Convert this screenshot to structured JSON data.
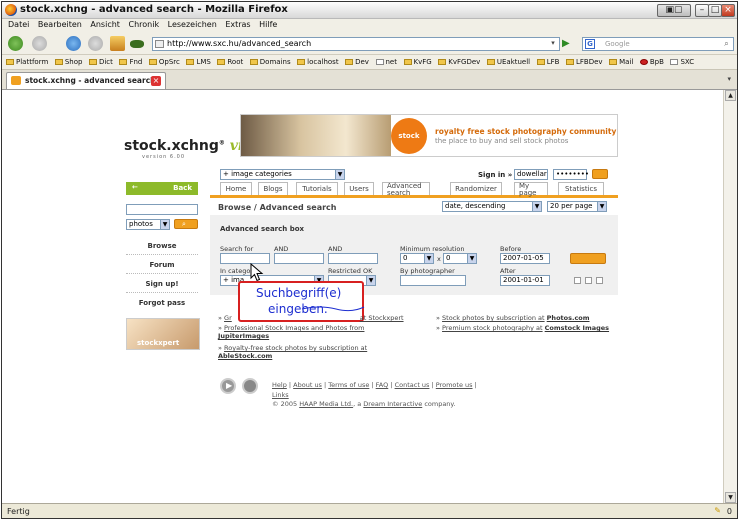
{
  "window": {
    "title": "stock.xchng - advanced search - Mozilla Firefox"
  },
  "menu": [
    "Datei",
    "Bearbeiten",
    "Ansicht",
    "Chronik",
    "Lesezeichen",
    "Extras",
    "Hilfe"
  ],
  "nav": {
    "url": "http://www.sxc.hu/advanced_search",
    "search_placeholder": "Google"
  },
  "bookmarks": [
    "Plattform",
    "Shop",
    "Dict",
    "Fnd",
    "OpSrc",
    "LMS",
    "Root",
    "Domains",
    "localhost",
    "Dev",
    "net",
    "KvFG",
    "KvFGDev",
    "UEaktuell",
    "LFB",
    "LFBDev",
    "Mail",
    "BpB",
    "SXC"
  ],
  "tab": {
    "label": "stock.xchng - advanced search"
  },
  "status": {
    "text": "Fertig",
    "count": "0"
  },
  "site": {
    "logo": "stock.xchng",
    "logo_vi": "vi",
    "logo_sub": "version 6.00",
    "banner_badge": "stock xpert",
    "banner_line1": "royalty free stock photography community",
    "banner_line2": "the place to buy and sell stock photos",
    "category_select": "+ image categories",
    "signin_label": "Sign in »",
    "signin_user": "dowellar",
    "signin_pass": "••••••••"
  },
  "leftnav": {
    "back": "Back",
    "search_type": "photos",
    "items": [
      "Browse",
      "Forum",
      "Sign up!",
      "Forgot pass"
    ],
    "banner": "stockxpert"
  },
  "navtabs": [
    "Home",
    "Blogs",
    "Tutorials",
    "Users",
    "Advanced search",
    "Randomizer",
    "My page",
    "Statistics"
  ],
  "breadcrumb": "Browse / Advanced search",
  "sort": {
    "order": "date, descending",
    "per_page": "20 per page"
  },
  "panel": {
    "title": "Advanced search box",
    "search_for": "Search for",
    "and1": "AND",
    "and2": "AND",
    "in_category": "In category",
    "category_value": "+ ima",
    "restricted": "Restricted OK",
    "min_res": "Minimum resolution",
    "res_w": "0",
    "res_x": "x",
    "res_h": "0",
    "by_photographer": "By photographer",
    "before": "Before",
    "before_value": "2007-01-05",
    "after": "After",
    "after_value": "2001-01-01"
  },
  "callout": {
    "line1": "Suchbegriff(e)",
    "line2": "eingeben."
  },
  "links": {
    "left": [
      {
        "pre": "Gr",
        "mid": "",
        "tail": "at Stockxpert"
      },
      {
        "pre": "Professional Stock Images and Photos from",
        "mid": "",
        "tail": "JupiterImages"
      },
      {
        "pre": "Royalty-free stock photos by subscription at",
        "mid": "",
        "tail": "AbleStock.com"
      }
    ],
    "right": [
      {
        "pre": "Stock photos by subscription at",
        "tail": "Photos.com"
      },
      {
        "pre": "Premium stock photography at",
        "tail": "Comstock Images"
      }
    ]
  },
  "footer": {
    "links": [
      "Help",
      "About us",
      "Terms of use",
      "FAQ",
      "Contact us",
      "Promote us",
      "Links"
    ],
    "copyright_pre": "© 2005",
    "company": "HAAP Media Ltd.",
    "mid": ", a",
    "parent": "Dream Interactive",
    "post": "company."
  }
}
